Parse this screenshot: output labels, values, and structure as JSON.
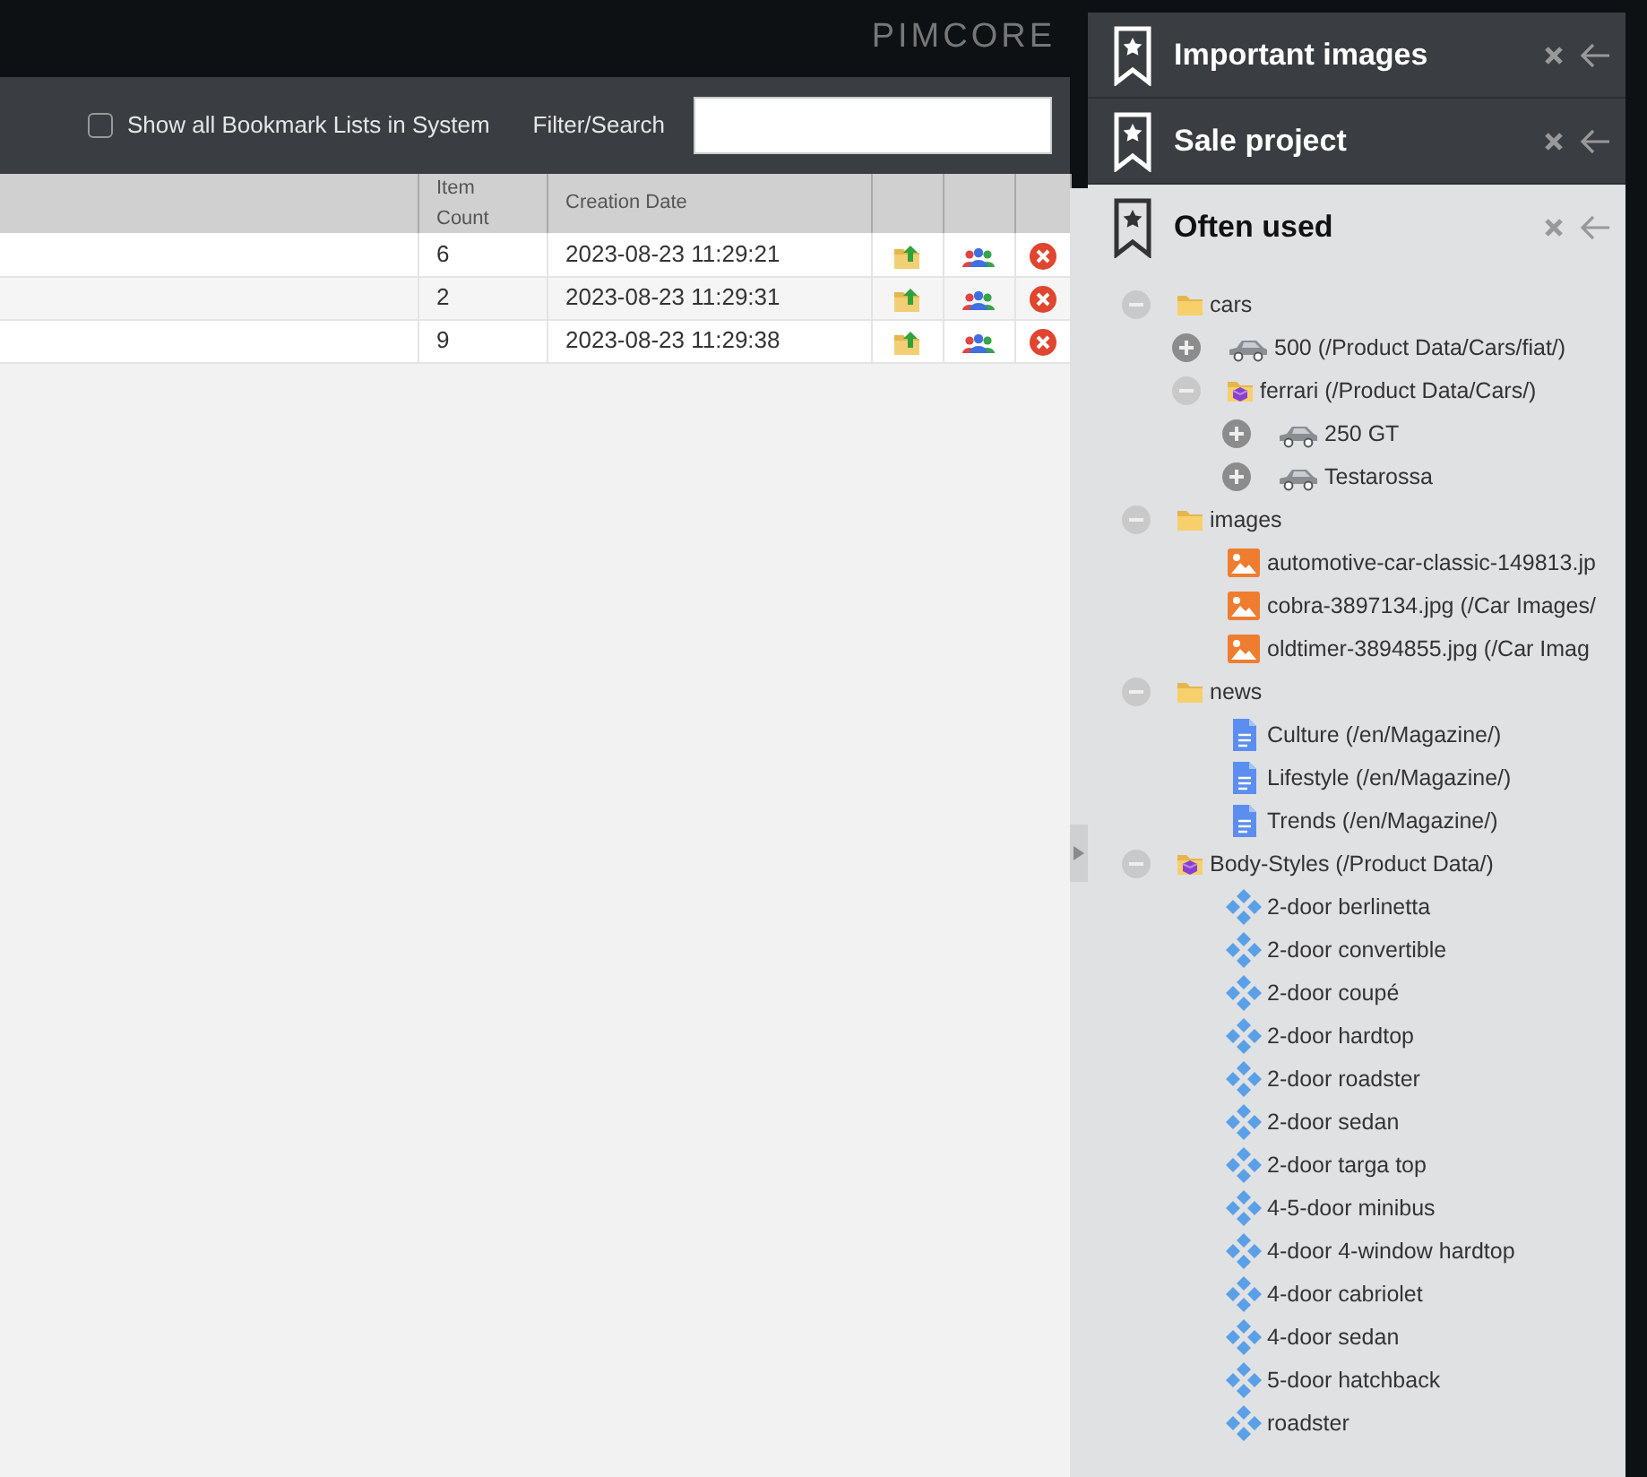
{
  "topbar": {
    "logo": "PIMCORE"
  },
  "toolbar": {
    "show_all": {
      "label": "Show all Bookmark Lists in System",
      "checked": false
    },
    "filter": {
      "label": "Filter/Search"
    }
  },
  "table": {
    "columns": [
      {
        "label": "Item Count"
      },
      {
        "label": "Creation Date"
      }
    ],
    "rows": [
      {
        "item_count": "6",
        "creation_date": "2023-08-23 11:29:21"
      },
      {
        "item_count": "2",
        "creation_date": "2023-08-23 11:29:31"
      },
      {
        "item_count": "9",
        "creation_date": "2023-08-23 11:29:38"
      }
    ]
  },
  "bookmark_lists": [
    {
      "title": "Important images",
      "expanded": false
    },
    {
      "title": "Sale project",
      "expanded": false
    },
    {
      "title": "Often used",
      "expanded": true,
      "tree": [
        {
          "label": "cars",
          "kind": "folder",
          "expanded": true,
          "children": [
            {
              "label": "500 (/Product Data/Cars/fiat/)",
              "kind": "car",
              "expanded": false
            },
            {
              "label": "ferrari (/Product Data/Cars/)",
              "kind": "object-folder",
              "expanded": true,
              "children": [
                {
                  "label": "250 GT",
                  "kind": "car",
                  "expanded": false
                },
                {
                  "label": "Testarossa",
                  "kind": "car",
                  "expanded": false
                }
              ]
            }
          ]
        },
        {
          "label": "images",
          "kind": "folder",
          "expanded": true,
          "children": [
            {
              "label": "automotive-car-classic-149813.jp",
              "kind": "image"
            },
            {
              "label": "cobra-3897134.jpg (/Car Images/",
              "kind": "image"
            },
            {
              "label": "oldtimer-3894855.jpg (/Car Imag",
              "kind": "image"
            }
          ]
        },
        {
          "label": "news",
          "kind": "folder",
          "expanded": true,
          "children": [
            {
              "label": "Culture (/en/Magazine/)",
              "kind": "document"
            },
            {
              "label": "Lifestyle (/en/Magazine/)",
              "kind": "document"
            },
            {
              "label": "Trends (/en/Magazine/)",
              "kind": "document"
            }
          ]
        },
        {
          "label": "Body-Styles (/Product Data/)",
          "kind": "object-folder",
          "expanded": true,
          "children": [
            {
              "label": "2-door berlinetta",
              "kind": "class-object"
            },
            {
              "label": "2-door convertible",
              "kind": "class-object"
            },
            {
              "label": "2-door coupé",
              "kind": "class-object"
            },
            {
              "label": "2-door hardtop",
              "kind": "class-object"
            },
            {
              "label": "2-door roadster",
              "kind": "class-object"
            },
            {
              "label": "2-door sedan",
              "kind": "class-object"
            },
            {
              "label": "2-door targa top",
              "kind": "class-object"
            },
            {
              "label": "4-5-door minibus",
              "kind": "class-object"
            },
            {
              "label": "4-door 4-window hardtop",
              "kind": "class-object"
            },
            {
              "label": "4-door cabriolet",
              "kind": "class-object"
            },
            {
              "label": "4-door sedan",
              "kind": "class-object"
            },
            {
              "label": "5-door hatchback",
              "kind": "class-object"
            },
            {
              "label": "roadster",
              "kind": "class-object"
            }
          ]
        }
      ]
    }
  ]
}
